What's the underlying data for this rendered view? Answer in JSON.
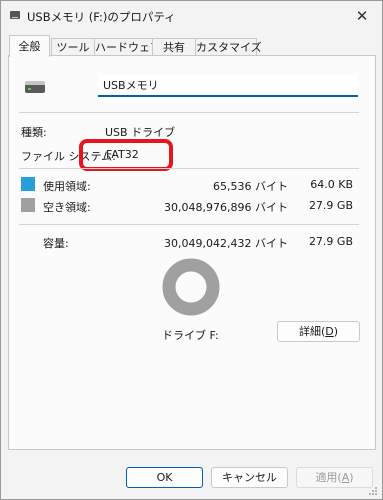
{
  "window": {
    "title": "USBメモリ (F:)のプロパティ",
    "close_glyph": "✕"
  },
  "tabs": [
    "全般",
    "ツール",
    "ハードウェア",
    "共有",
    "カスタマイズ"
  ],
  "general": {
    "volume_name": "USBメモリ",
    "type_label": "種類:",
    "type_value": "USB ドライブ",
    "fs_label": "ファイル システム:",
    "fs_value": "FAT32",
    "used_label": "使用領域:",
    "used_bytes": "65,536 バイト",
    "used_size": "64.0 KB",
    "used_color": "#26a0da",
    "free_label": "空き領域:",
    "free_bytes": "30,048,976,896 バイト",
    "free_size": "27.9 GB",
    "free_color": "#a0a0a0",
    "capacity_label": "容量:",
    "capacity_bytes": "30,049,042,432 バイト",
    "capacity_size": "27.9 GB",
    "usage_fraction": 2.2e-06,
    "drive_label": "ドライブ F:",
    "details_button": "詳細(D)",
    "details_button_pre": "詳細(",
    "details_button_key": "D",
    "details_button_post": ")"
  },
  "buttons": {
    "ok": "OK",
    "cancel": "キャンセル",
    "apply": "適用(A)",
    "apply_pre": "適用(",
    "apply_key": "A",
    "apply_post": ")"
  },
  "annotation": {
    "color": "#e8141e"
  }
}
